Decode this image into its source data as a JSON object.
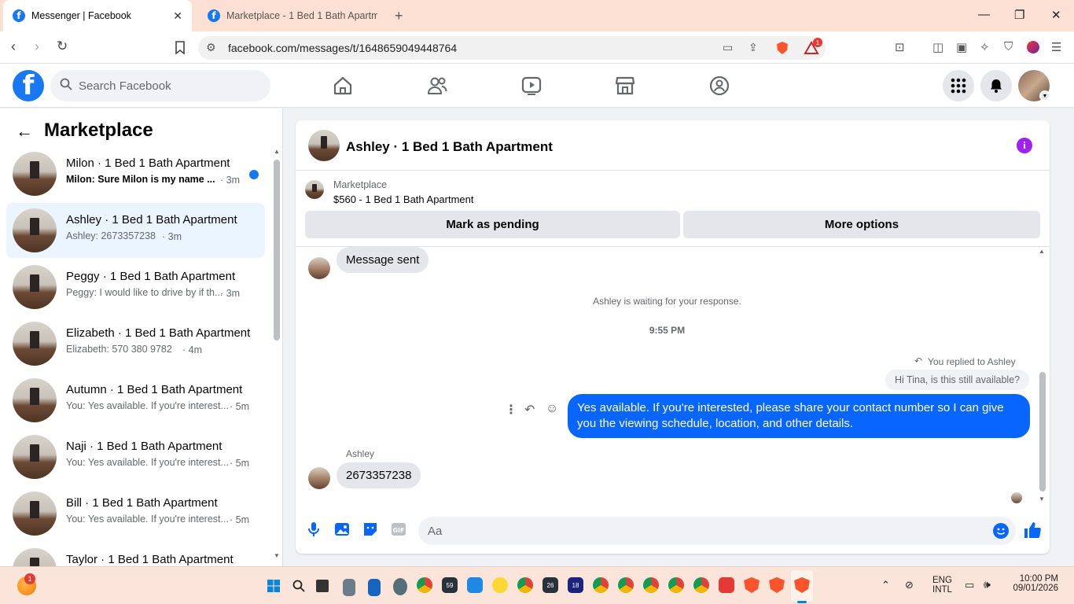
{
  "browser": {
    "tabs": [
      {
        "title": "Messenger | Facebook",
        "active": true
      },
      {
        "title": "Marketplace - 1 Bed 1 Bath Apartmen",
        "active": false
      }
    ],
    "url": "facebook.com/messages/t/1648659049448764",
    "brave_badge": "1"
  },
  "header": {
    "search_placeholder": "Search Facebook",
    "nav_icons": [
      "home-icon",
      "friends-icon",
      "video-icon",
      "marketplace-icon",
      "groups-icon"
    ]
  },
  "sidebar": {
    "title": "Marketplace",
    "conversations": [
      {
        "name": "Milon · 1 Bed 1 Bath Apartment",
        "snippet": "Milon: Sure Milon is my name ...",
        "time": "3m",
        "unread": true
      },
      {
        "name": "Ashley · 1 Bed 1 Bath Apartment",
        "snippet": "Ashley: 2673357238",
        "time": "3m",
        "selected": true
      },
      {
        "name": "Peggy · 1 Bed 1 Bath Apartment",
        "snippet": "Peggy: I would like to drive by if th...",
        "time": "3m"
      },
      {
        "name": "Elizabeth · 1 Bed 1 Bath Apartment",
        "snippet": "Elizabeth: 570 380 9782",
        "time": "4m"
      },
      {
        "name": "Autumn · 1 Bed 1 Bath Apartment",
        "snippet": "You: Yes available. If you're interest...",
        "time": "5m"
      },
      {
        "name": "Naji · 1 Bed 1 Bath Apartment",
        "snippet": "You: Yes available. If you're interest...",
        "time": "5m"
      },
      {
        "name": "Bill · 1 Bed 1 Bath Apartment",
        "snippet": "You: Yes available. If you're interest...",
        "time": "5m"
      },
      {
        "name": "Taylor · 1 Bed 1 Bath Apartment",
        "snippet": "",
        "time": ""
      }
    ]
  },
  "chat": {
    "title": "Ashley · 1 Bed 1 Bath Apartment",
    "listing_source": "Marketplace",
    "listing_price": "$560 - 1 Bed 1 Bath Apartment",
    "mark_pending_label": "Mark as pending",
    "more_options_label": "More options",
    "msg_sent": "Message sent",
    "waiting_text": "Ashley is waiting for your response.",
    "timestamp": "9:55 PM",
    "reply_label": "You replied to Ashley",
    "quoted_text": "Hi Tina, is this still available?",
    "outgoing_text": "Yes available. If you're interested, please share your contact number so I can give you the viewing schedule, location, and other details.",
    "sender_name": "Ashley",
    "incoming_text": "2673357238",
    "composer_placeholder": "Aa"
  },
  "taskbar": {
    "weather_badge": "1",
    "lang1": "ENG",
    "lang2": "INTL",
    "time": "10:00 PM",
    "date": "09/01/2026",
    "badges": [
      "59",
      "26",
      "18"
    ]
  },
  "colors": {
    "facebook_blue": "#1877f2",
    "messenger_blue": "#0866ff",
    "info_purple": "#a020f0"
  }
}
